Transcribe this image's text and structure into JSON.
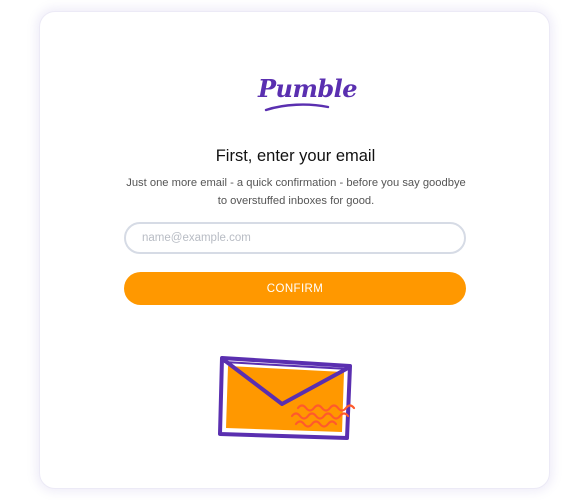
{
  "logo": {
    "text": "Pumble",
    "color": "#5a2fb0"
  },
  "heading": "First, enter your email",
  "description": "Just one more email - a quick confirmation - before you say goodbye to overstuffed inboxes for good.",
  "email_field": {
    "value": "",
    "placeholder": "name@example.com"
  },
  "confirm_button": {
    "label": "CONFIRM",
    "color": "#ff9800"
  },
  "illustration": {
    "icon": "envelope-icon",
    "colors": {
      "envelope_fill": "#ff9800",
      "envelope_outline": "#5a2fb0",
      "waves": "#ff5a2c"
    }
  }
}
